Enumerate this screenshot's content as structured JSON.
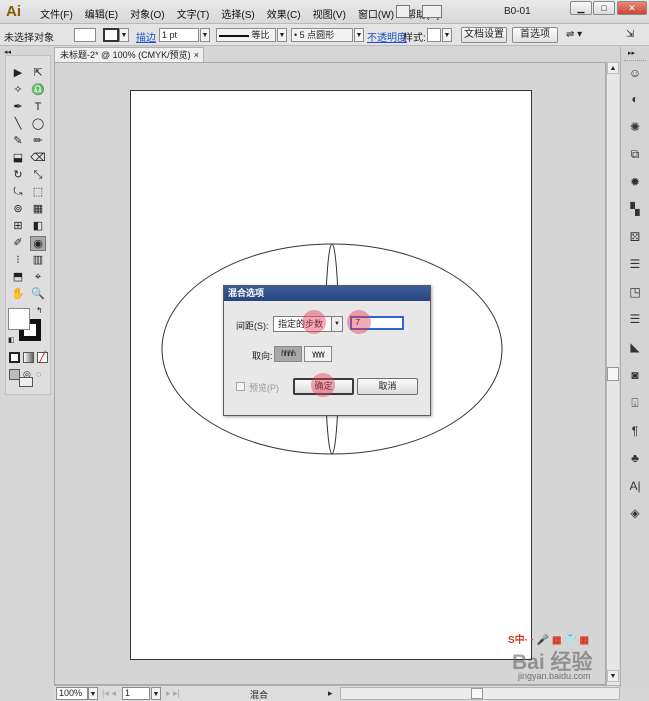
{
  "app": {
    "logo": "Ai",
    "workspace": "B0-01",
    "win_min": "▁",
    "win_max": "□",
    "win_close": "✕"
  },
  "menu": [
    "文件(F)",
    "编辑(E)",
    "对象(O)",
    "文字(T)",
    "选择(S)",
    "效果(C)",
    "视图(V)",
    "窗口(W)",
    "帮助(H)"
  ],
  "control_bar": {
    "selection": "未选择对象",
    "stroke_label": "描边",
    "stroke_weight": "1 pt",
    "stroke_profile": "等比",
    "brush": "5 点圆形",
    "opacity_label": "不透明度",
    "style_label": "样式:",
    "doc_setup": "文档设置",
    "preferences": "首选项"
  },
  "document": {
    "tab_title": "未标题-2* @ 100% (CMYK/预览)",
    "close": "×"
  },
  "dialog": {
    "title": "混合选项",
    "spacing_label": "间距(S):",
    "spacing_value": "指定的步数",
    "steps_value": "7",
    "orientation_label": "取向:",
    "orientation_align_page": "ɦɦɦɦ",
    "orientation_align_path": "ɣɣɣɣ",
    "preview_label": "预览(P)",
    "ok": "确定",
    "cancel": "取消"
  },
  "status_bar": {
    "zoom": "100%",
    "artboard_num": "1",
    "status": "混合"
  },
  "tools": [
    "▶",
    "⇱",
    "✧",
    "♎",
    "✒",
    "T",
    "╲",
    "◯",
    "✎",
    "✏",
    "⬓",
    "⌫",
    "↻",
    "⤡",
    "⤿",
    "⬚",
    "⊚",
    "▦",
    "⊞",
    "◧",
    "✐",
    "◉",
    "⁝",
    "▥",
    "⬒",
    "⌖",
    "✋",
    "🔍"
  ],
  "dock_icons": [
    "☺",
    "◐",
    "✺",
    "⧉",
    "✹",
    "▚",
    "⚄",
    "☰",
    "◳",
    "☰",
    "◣",
    "◙",
    "⍗",
    "¶",
    "♣",
    "A|",
    "◈"
  ],
  "watermark": {
    "bar": "S中·◔ 🎤 ▦ 👕 ▦",
    "brand": "Bai 经验",
    "url": "jingyan.baidu.com"
  },
  "colors": {
    "accent": "#3265c8",
    "dialog_title": "#2f4f8a",
    "marker": "#e63c5a"
  }
}
